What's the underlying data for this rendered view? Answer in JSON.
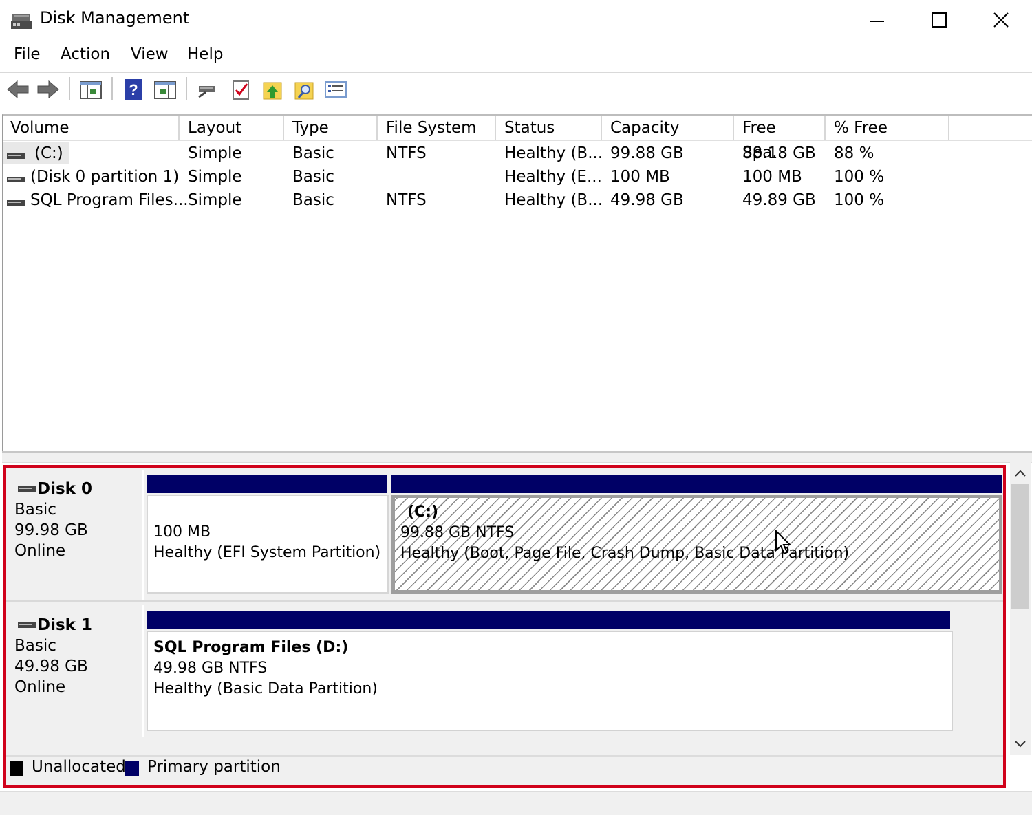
{
  "window": {
    "title": "Disk Management"
  },
  "menu": [
    "File",
    "Action",
    "View",
    "Help"
  ],
  "toolbar": [
    "back-icon",
    "forward-icon",
    "console-tree-icon",
    "help-icon",
    "show-hide-pane-icon",
    "connect-icon",
    "properties-check-icon",
    "import-up-icon",
    "search-folder-icon",
    "list-view-icon"
  ],
  "list": {
    "columns": [
      "Volume",
      "Layout",
      "Type",
      "File System",
      "Status",
      "Capacity",
      "Free Spa...",
      "% Free"
    ],
    "rows": [
      [
        "(C:)",
        "Simple",
        "Basic",
        "NTFS",
        "Healthy (B...",
        "99.88 GB",
        "88.18 GB",
        "88 %"
      ],
      [
        "(Disk 0 partition 1)",
        "Simple",
        "Basic",
        "",
        "Healthy (E...",
        "100 MB",
        "100 MB",
        "100 %"
      ],
      [
        "SQL Program Files...",
        "Simple",
        "Basic",
        "NTFS",
        "Healthy (B...",
        "49.98 GB",
        "49.89 GB",
        "100 %"
      ]
    ]
  },
  "disks": [
    {
      "name": "Disk 0",
      "type": "Basic",
      "size": "99.98 GB",
      "state": "Online",
      "partitions": [
        {
          "title": "",
          "size": "100 MB",
          "status": "Healthy (EFI System Partition)"
        },
        {
          "title": "(C:)",
          "size": "99.88 GB NTFS",
          "status": "Healthy (Boot, Page File, Crash Dump, Basic Data Partition)"
        }
      ]
    },
    {
      "name": "Disk 1",
      "type": "Basic",
      "size": "49.98 GB",
      "state": "Online",
      "partitions": [
        {
          "title": "SQL Program Files  (D:)",
          "size": "49.98 GB NTFS",
          "status": "Healthy (Basic Data Partition)"
        }
      ]
    }
  ],
  "legend": [
    {
      "label": "Unallocated",
      "color": "#000000"
    },
    {
      "label": "Primary partition",
      "color": "#000066"
    }
  ],
  "colors": {
    "primary_partition": "#000066",
    "highlight": "#d0021b"
  }
}
